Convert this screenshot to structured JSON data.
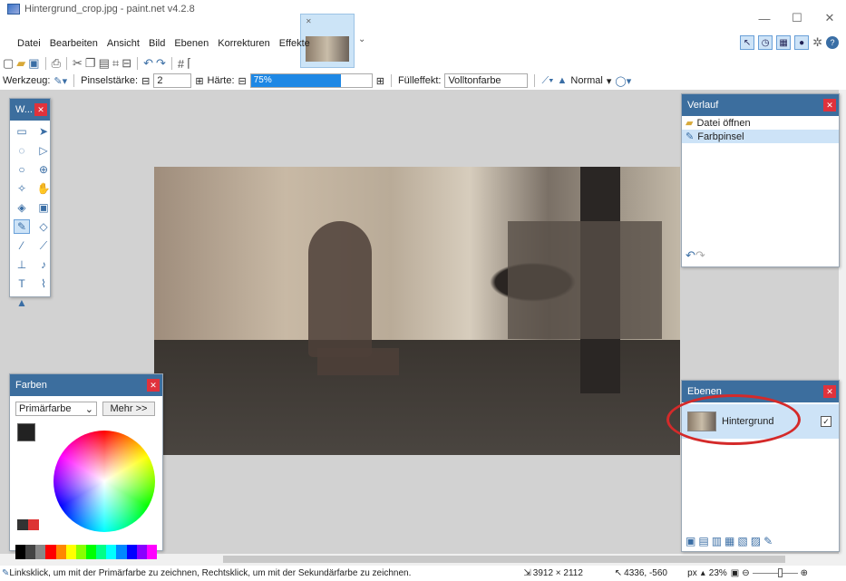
{
  "window": {
    "title": "Hintergrund_crop.jpg - paint.net v4.2.8",
    "minimize": "—",
    "maximize": "☐",
    "close": "✕"
  },
  "thumbnail": {
    "close": "✕",
    "arrow": "⌄"
  },
  "menu": [
    "Datei",
    "Bearbeiten",
    "Ansicht",
    "Bild",
    "Ebenen",
    "Korrekturen",
    "Effekte"
  ],
  "toolbar": {
    "tool_label": "Werkzeug:",
    "brush_width_label": "Pinselstärke:",
    "brush_width_value": "2",
    "hardness_label": "Härte:",
    "hardness_value": "75%",
    "hardness_fraction": 0.75,
    "fill_label": "Fülleffekt:",
    "fill_value": "Volltonfarbe",
    "blend_mode": "Normal"
  },
  "panels": {
    "tools": {
      "title": "W..."
    },
    "colors": {
      "title": "Farben",
      "primary_select": "Primärfarbe",
      "more_button": "Mehr >>"
    },
    "history": {
      "title": "Verlauf",
      "items": [
        "Datei öffnen",
        "Farbpinsel"
      ]
    },
    "layers": {
      "title": "Ebenen",
      "items": [
        {
          "name": "Hintergrund",
          "visible": true
        }
      ]
    }
  },
  "status": {
    "hint": "Linksklick, um mit der Primärfarbe zu zeichnen, Rechtsklick, um mit der Sekundärfarbe zu zeichnen.",
    "image_size": "3912 × 2112",
    "cursor_pos": "4336, -560",
    "unit": "px",
    "zoom": "23%"
  },
  "colors": {
    "accent": "#3c6e9e",
    "selection": "#cde3f7",
    "close": "#e0323c",
    "annotation": "#d42a2a"
  }
}
